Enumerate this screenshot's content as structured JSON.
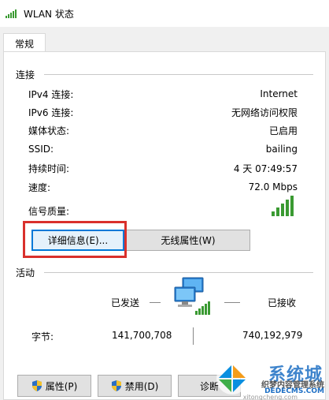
{
  "window": {
    "title": "WLAN 状态",
    "icon": "wifi-signal-icon"
  },
  "tabs": [
    {
      "label": "常规",
      "selected": true
    }
  ],
  "connection": {
    "heading": "连接",
    "rows": [
      {
        "label": "IPv4 连接:",
        "value": "Internet"
      },
      {
        "label": "IPv6 连接:",
        "value": "无网络访问权限"
      },
      {
        "label": "媒体状态:",
        "value": "已启用"
      },
      {
        "label": "SSID:",
        "value": "bailing"
      },
      {
        "label": "持续时间:",
        "value": "4 天 07:49:57"
      },
      {
        "label": "速度:",
        "value": "72.0 Mbps"
      }
    ],
    "signal_label": "信号质量:",
    "signal_level": 5,
    "signal_max": 5,
    "details_button": "详细信息(E)...",
    "wireless_props_button": "无线属性(W)"
  },
  "activity": {
    "heading": "活动",
    "sent_label": "已发送",
    "received_label": "已接收",
    "bytes_label": "字节:",
    "bytes_sent": "141,700,708",
    "bytes_received": "740,192,979",
    "network_icon": "network-computers-icon"
  },
  "bottom_buttons": {
    "properties": "属性(P)",
    "disable": "禁用(D)",
    "diagnose": "诊断"
  },
  "watermark": {
    "brand": "系统城",
    "line1": "织梦内容管理系统",
    "line2": "DEDECMS.COM",
    "site": "xitongcheng.com"
  },
  "colors": {
    "highlight": "#d9302c",
    "signal": "#3a9a32",
    "focus": "#0078d7"
  }
}
